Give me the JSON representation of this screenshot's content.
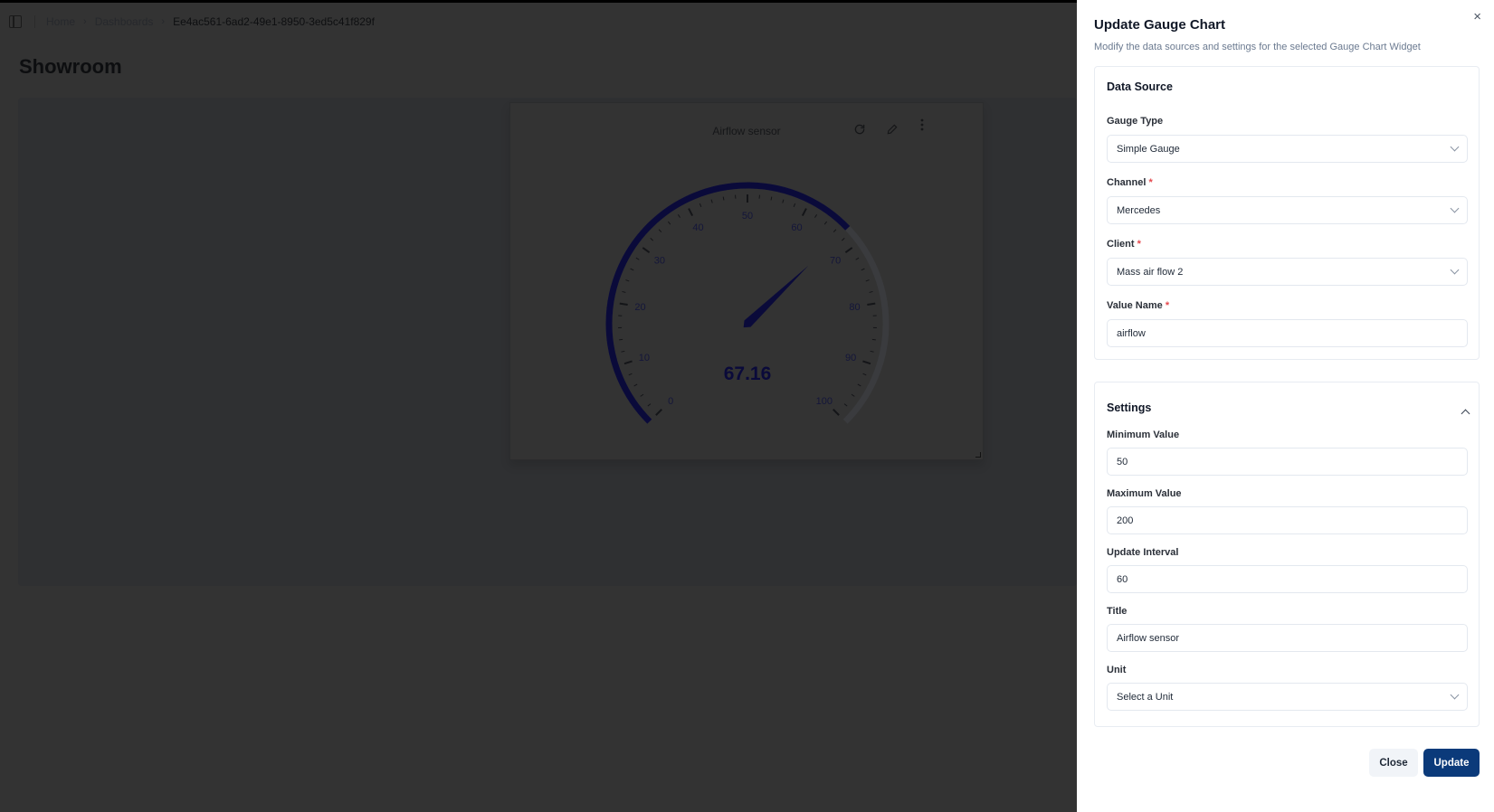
{
  "breadcrumb": {
    "items": [
      "Home",
      "Dashboards"
    ],
    "current": "Ee4ac561-6ad2-49e1-8950-3ed5c41f829f"
  },
  "page": {
    "title": "Showroom"
  },
  "widget": {
    "title": "Airflow sensor",
    "icons": [
      "refresh-icon",
      "pencil-icon",
      "more-vertical-icon"
    ]
  },
  "chart_data": {
    "type": "gauge",
    "title": "Airflow sensor",
    "value": 67.16,
    "value_label": "67.16",
    "range": [
      0,
      100
    ],
    "major_ticks": [
      0,
      10,
      20,
      30,
      40,
      50,
      60,
      70,
      80,
      90,
      100
    ],
    "tick_labels": [
      "0",
      "10",
      "20",
      "30",
      "40",
      "50",
      "60",
      "70",
      "80",
      "90",
      "100"
    ],
    "minor_ticks_per_major": 5,
    "fill_color": "#0a0a3a",
    "track_color": "#3a3b3e"
  },
  "panel": {
    "title": "Update Gauge Chart",
    "subtitle": "Modify the data sources and settings for the selected Gauge Chart Widget",
    "close_icon": "×",
    "data_source": {
      "title": "Data Source",
      "gauge_type": {
        "label": "Gauge Type",
        "value": "Simple Gauge"
      },
      "channel": {
        "label": "Channel",
        "required": "*",
        "value": "Mercedes"
      },
      "client": {
        "label": "Client",
        "required": "*",
        "value": "Mass air flow 2"
      },
      "value_name": {
        "label": "Value Name",
        "required": "*",
        "value": "airflow"
      }
    },
    "settings": {
      "title": "Settings",
      "min": {
        "label": "Minimum Value",
        "value": "50"
      },
      "max": {
        "label": "Maximum Value",
        "value": "200"
      },
      "interval": {
        "label": "Update Interval",
        "value": "60"
      },
      "title_field": {
        "label": "Title",
        "value": "Airflow sensor"
      },
      "unit": {
        "label": "Unit",
        "placeholder": "Select a Unit"
      }
    },
    "buttons": {
      "close": "Close",
      "update": "Update"
    }
  },
  "colors": {
    "accent": "#0b3a7a",
    "overlay": "#333333",
    "required": "#e5484d"
  }
}
